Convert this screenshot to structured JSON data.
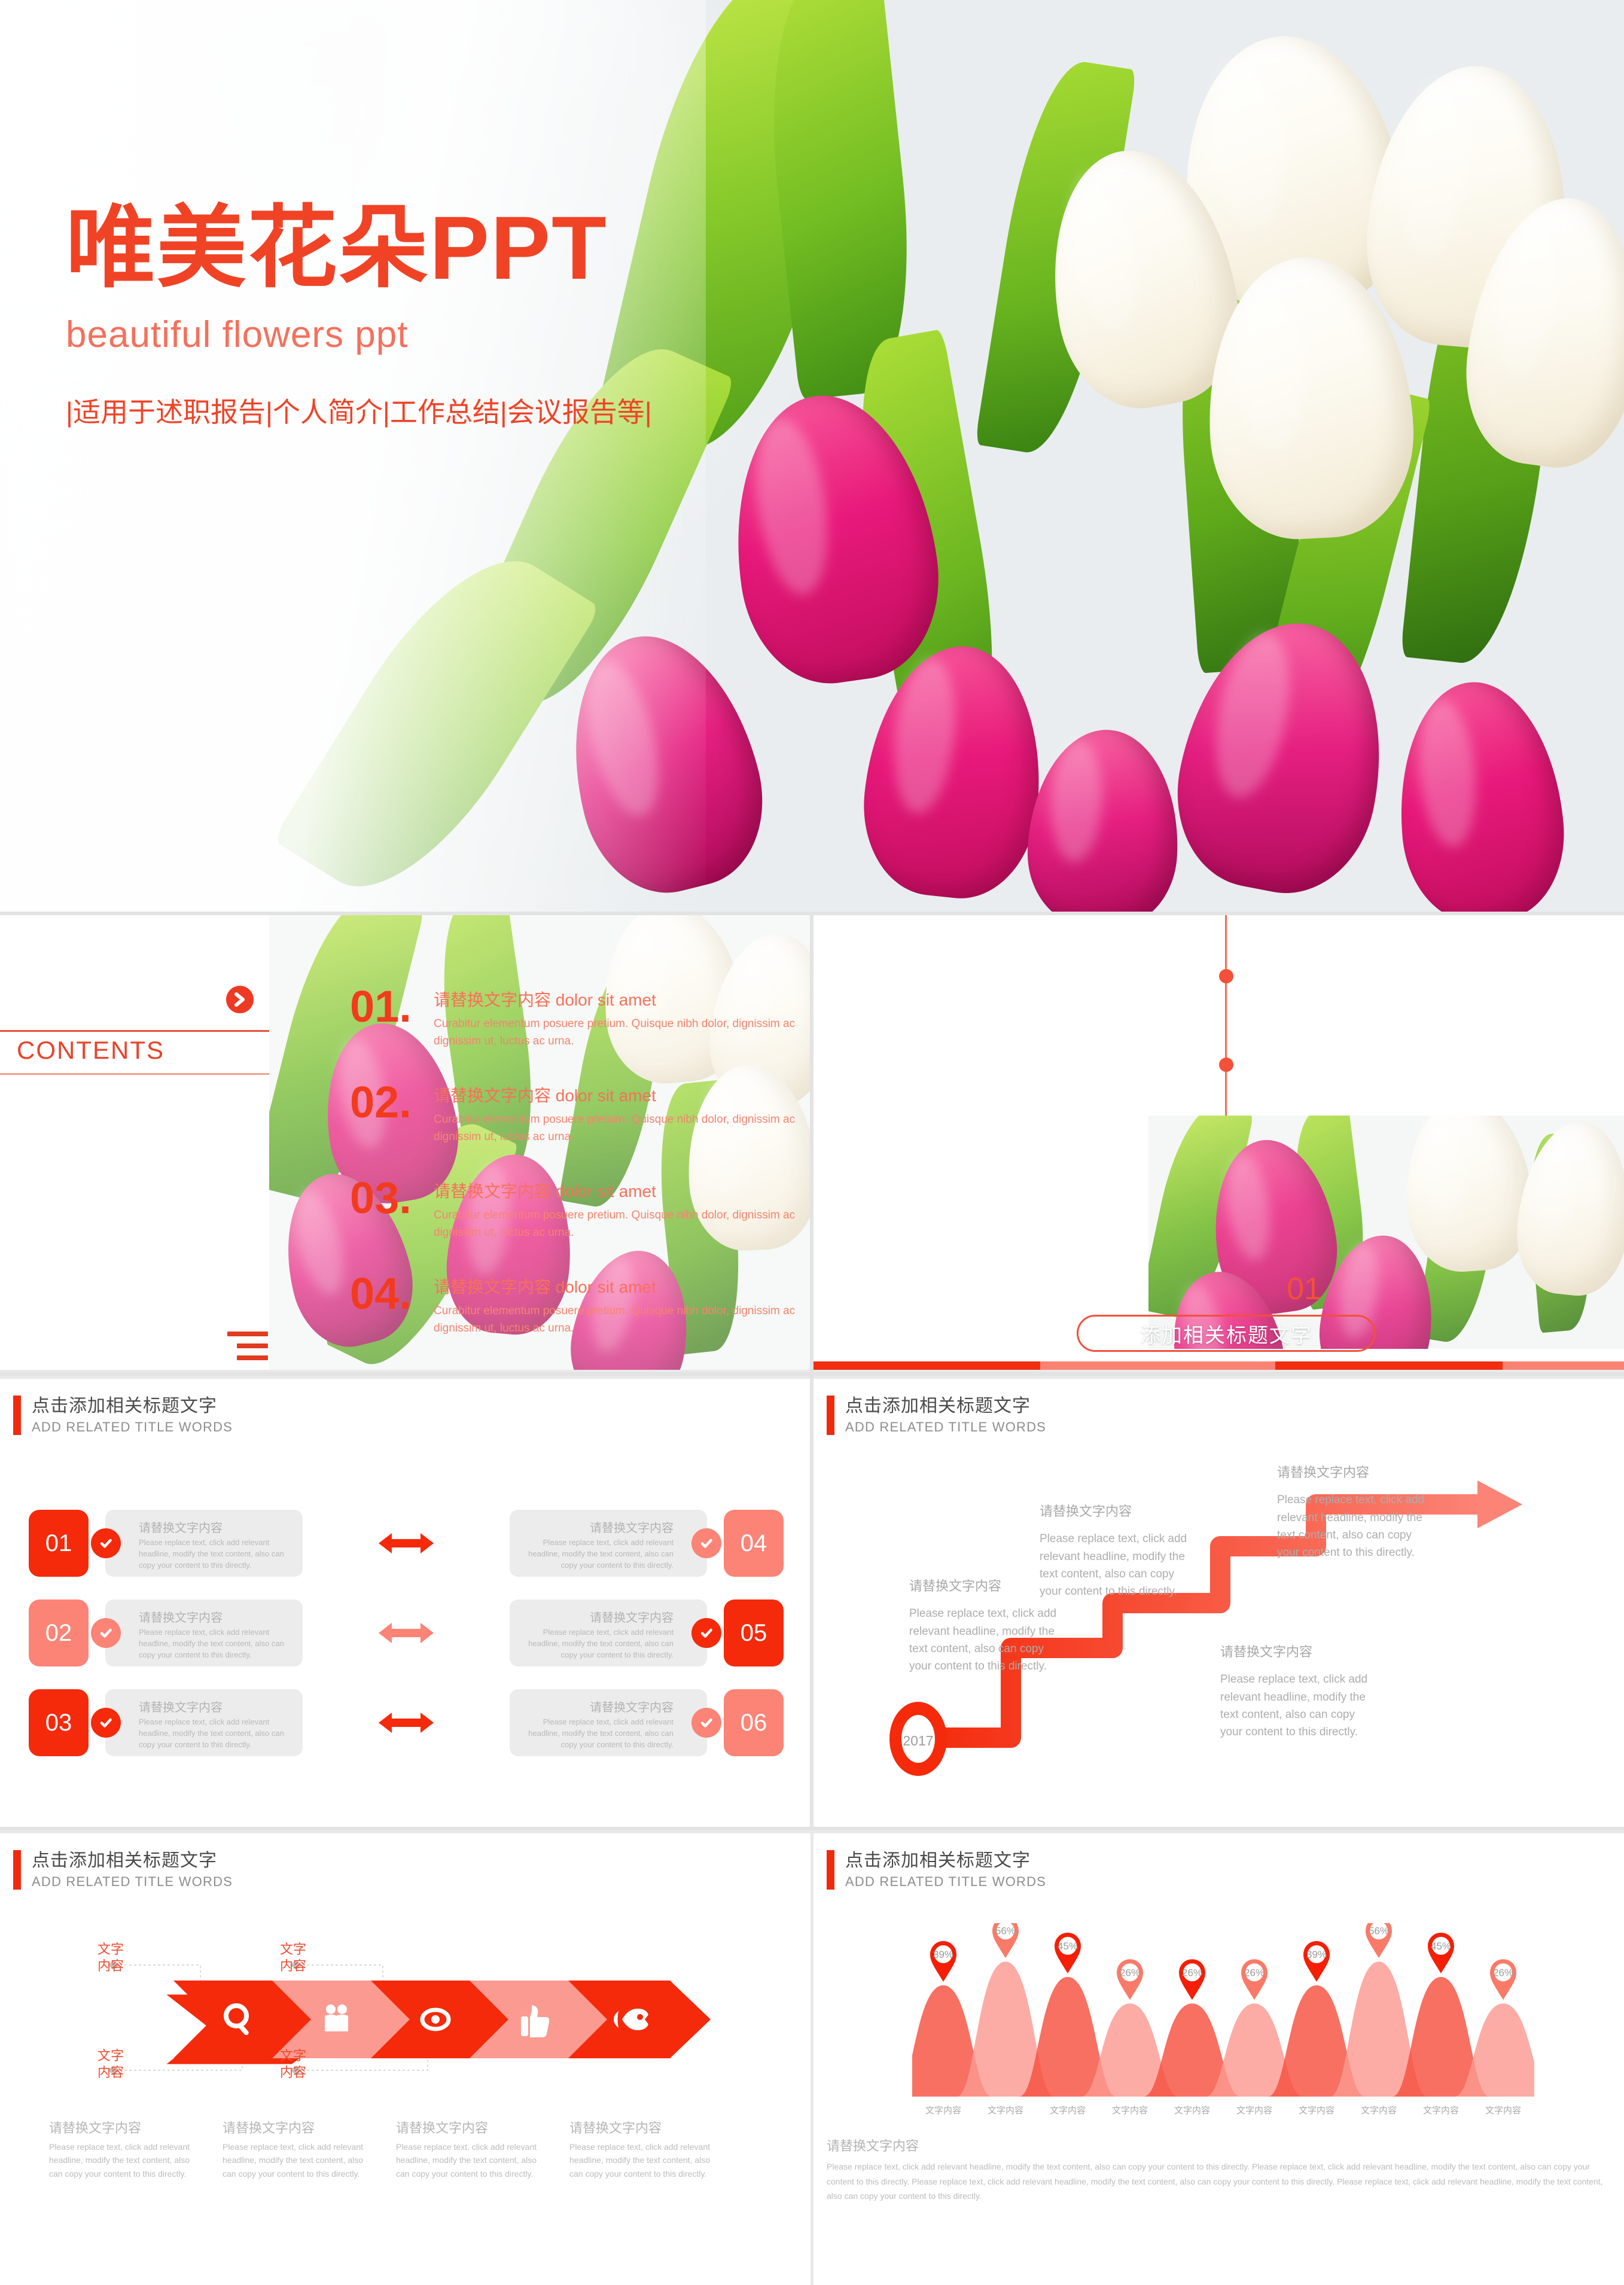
{
  "cover": {
    "title": "唯美花朵PPT",
    "subtitle": "beautiful flowers ppt",
    "tagline": "|适用于述职报告|个人简介|工作总结|会议报告等|",
    "accent": "#f04326"
  },
  "contents": {
    "label": "CONTENTS",
    "chevron_icon": "chevron-right-icon",
    "menu_icon": "hamburger-icon",
    "items": [
      {
        "num": "01.",
        "heading": "请替换文字内容 dolor sit amet",
        "body": "Curabitur elementum posuere pretium. Quisque nibh dolor, dignissim ac dignissim ut, luctus ac urna."
      },
      {
        "num": "02.",
        "heading": "请替换文字内容 dolor sit amet",
        "body": "Curabitur elementum posuere pretium. Quisque nibh dolor, dignissim ac dignissim ut, luctus ac urna."
      },
      {
        "num": "03.",
        "heading": "请替换文字内容 dolor sit amet",
        "body": "Curabitur elementum posuere pretium. Quisque nibh dolor, dignissim ac dignissim ut, luctus ac urna."
      },
      {
        "num": "04.",
        "heading": "请替换文字内容 dolor sit amet",
        "body": "Curabitur elementum posuere pretium. Quisque nibh dolor, dignissim ac dignissim ut, luctus ac urna."
      }
    ]
  },
  "divider": {
    "number": "01",
    "title": "添加相关标题文字"
  },
  "section_header": {
    "title_cn": "点击添加相关标题文字",
    "title_en": "ADD RELATED TITLE WORDS"
  },
  "blocks_slide": {
    "heading": "请替换文字内容",
    "body": "Please replace text, click add relevant headline, modify the text content, also can copy your content to this directly.",
    "check_icon": "check-circle-icon",
    "arrow_icon": "double-arrow-icon",
    "rows": [
      {
        "left_num": "01",
        "right_num": "04",
        "left_tone": "strong",
        "right_tone": "soft",
        "arrow_tone": "strong"
      },
      {
        "left_num": "02",
        "right_num": "05",
        "left_tone": "soft",
        "right_tone": "strong",
        "arrow_tone": "soft"
      },
      {
        "left_num": "03",
        "right_num": "06",
        "left_tone": "strong",
        "right_tone": "soft",
        "arrow_tone": "strong"
      }
    ]
  },
  "stairs_slide": {
    "start_year": "2017",
    "footer": "Please replace text, click add relevant headline, modify the text content, also can copy your content to this directly.",
    "steps": [
      {
        "heading": "请替换文字内容",
        "body": "Please replace text, click add relevant headline, modify the text content, also can copy your content to this directly."
      },
      {
        "heading": "请替换文字内容",
        "body": "Please replace text, click add relevant headline, modify the text content, also can copy your content to this directly."
      },
      {
        "heading": "请替换文字内容",
        "body": "Please replace text, click add relevant headline, modify the text content, also can copy your content to this directly."
      },
      {
        "heading": "请替换文字内容",
        "body": "Please replace text, click add relevant headline, modify the text content, also can copy your content to this directly."
      }
    ]
  },
  "process_slide": {
    "chevrons": [
      {
        "icon": "magnifier-icon",
        "tone": "strong"
      },
      {
        "icon": "people-icon",
        "tone": "soft"
      },
      {
        "icon": "eye-icon",
        "tone": "strong"
      },
      {
        "icon": "thumbs-up-icon",
        "tone": "soft"
      },
      {
        "icon": "rocket-icon",
        "tone": "strong"
      }
    ],
    "callouts": [
      {
        "line1": "文字",
        "line2": "内容"
      },
      {
        "line1": "文字",
        "line2": "内容"
      },
      {
        "line1": "文字",
        "line2": "内容"
      },
      {
        "line1": "文字",
        "line2": "内容"
      }
    ],
    "captions": [
      {
        "heading": "请替换文字内容",
        "body": "Please replace text, click add relevant headline, modify the text content, also can copy your content to this directly."
      },
      {
        "heading": "请替换文字内容",
        "body": "Please replace text, click add relevant headline, modify the text content, also can copy your content to this directly."
      },
      {
        "heading": "请替换文字内容",
        "body": "Please replace text, click add relevant headline, modify the text content, also can copy your content to this directly."
      },
      {
        "heading": "请替换文字内容",
        "body": "Please replace text, click add relevant headline, modify the text content, also can copy your content to this directly."
      }
    ]
  },
  "chart_slide": {
    "footer_heading": "请替换文字内容",
    "footer_body": "Please replace text, click add relevant headline, modify the text content, also can copy your content to this directly. Please replace text, click add relevant headline, modify the text content, also can copy your content to this directly. Please replace text, click add relevant headline, modify the text content, also can copy your content to this directly. Please replace text, click add relevant headline, modify the text content, also can copy your content to this directly."
  },
  "chart_data": {
    "type": "bar",
    "title": "点击添加相关标题文字",
    "subtitle": "ADD RELATED TITLE WORDS",
    "xlabel": "",
    "ylabel": "",
    "ylim": [
      0,
      100
    ],
    "grid": false,
    "legend": "none",
    "categories": [
      "文字内容",
      "文字内容",
      "文字内容",
      "文字内容",
      "文字内容",
      "文字内容",
      "文字内容",
      "文字内容",
      "文字内容",
      "文字内容"
    ],
    "values": [
      39,
      56,
      45,
      26,
      26,
      26,
      39,
      56,
      45,
      26
    ],
    "data_labels": [
      "39%",
      "56%",
      "45%",
      "26%",
      "26%",
      "26%",
      "39%",
      "56%",
      "45%",
      "26%"
    ],
    "bar_tones": [
      "strong",
      "soft",
      "strong",
      "soft",
      "strong",
      "soft",
      "strong",
      "soft",
      "strong",
      "soft"
    ],
    "pin_tones": [
      "strong",
      "soft",
      "strong",
      "soft",
      "strong",
      "soft",
      "strong",
      "soft",
      "strong",
      "soft"
    ],
    "colors": {
      "strong": "#f5503f",
      "soft": "#fb9a91",
      "pin_strong": "#f41f06",
      "pin_soft": "#fa7a68"
    }
  }
}
